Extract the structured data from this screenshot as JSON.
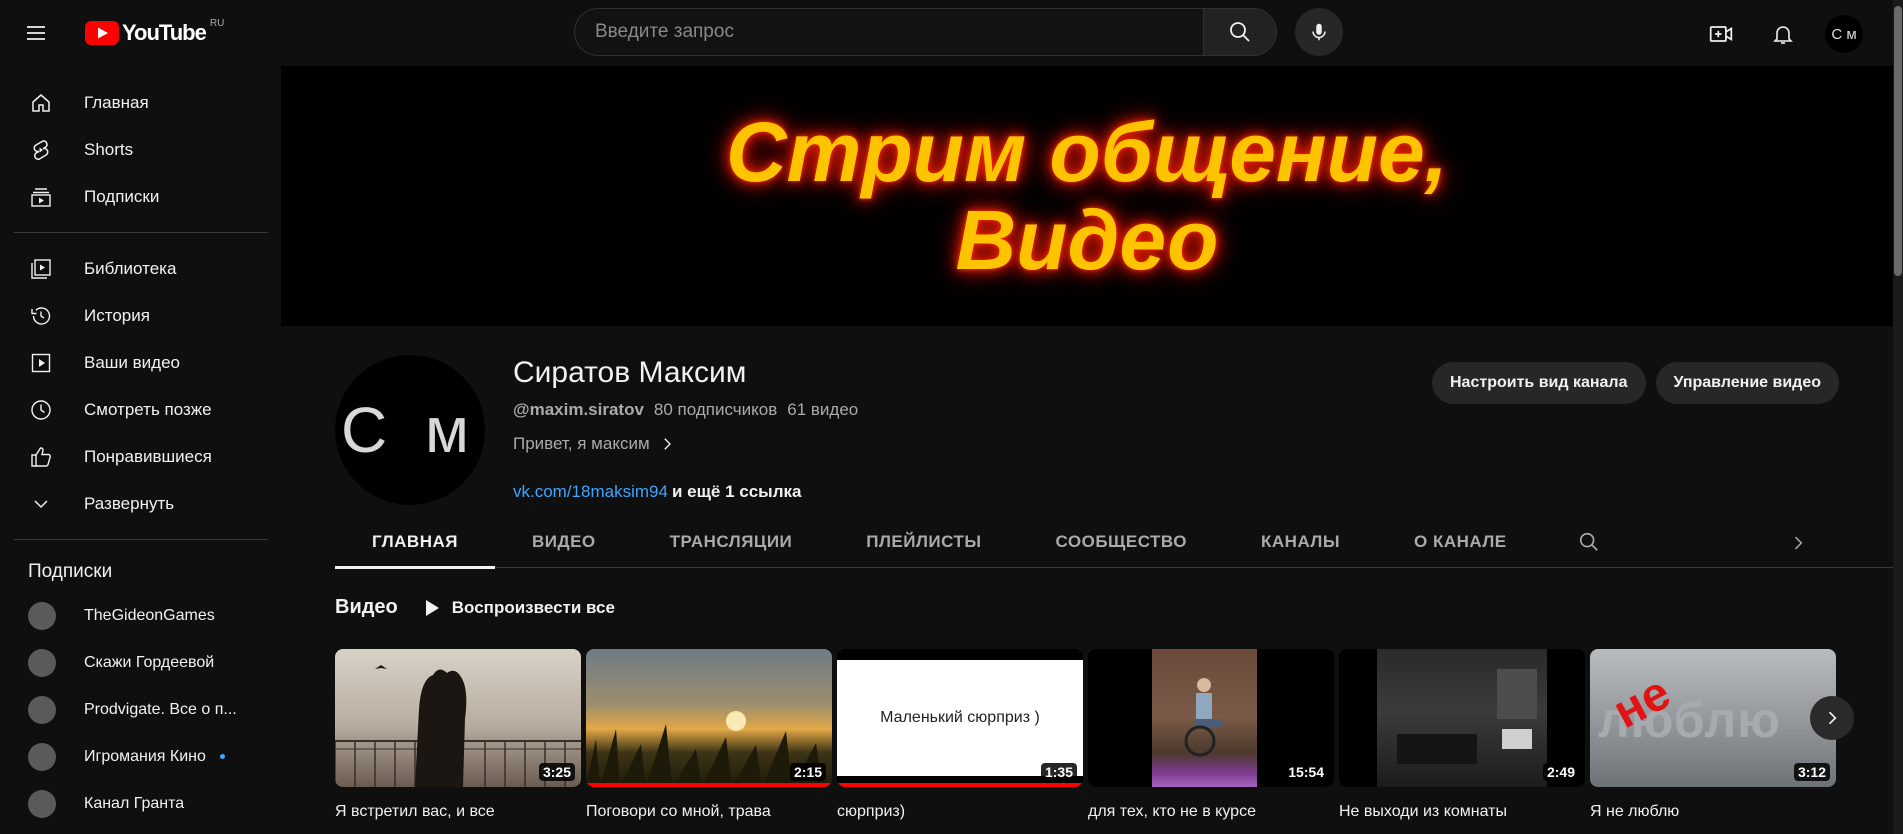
{
  "header": {
    "logo_text": "YouTube",
    "logo_region": "RU",
    "search_placeholder": "Введите запрос",
    "avatar_initials": "С м"
  },
  "sidebar": {
    "main_items": [
      {
        "label": "Главная",
        "icon": "home-icon"
      },
      {
        "label": "Shorts",
        "icon": "shorts-icon"
      },
      {
        "label": "Подписки",
        "icon": "subscriptions-icon"
      }
    ],
    "library_items": [
      {
        "label": "Библиотека",
        "icon": "library-icon"
      },
      {
        "label": "История",
        "icon": "history-icon"
      },
      {
        "label": "Ваши видео",
        "icon": "your-videos-icon"
      },
      {
        "label": "Смотреть позже",
        "icon": "watch-later-icon"
      },
      {
        "label": "Понравившиеся",
        "icon": "thumbs-up-icon"
      },
      {
        "label": "Развернуть",
        "icon": "chevron-down-icon"
      }
    ],
    "subscriptions_heading": "Подписки",
    "subscriptions": [
      {
        "name": "TheGideonGames",
        "new": false
      },
      {
        "name": "Скажи Гордеевой",
        "new": false
      },
      {
        "name": "Prodvigate. Все о п...",
        "new": false
      },
      {
        "name": "Игромания Кино",
        "new": true
      },
      {
        "name": "Канал Гранта",
        "new": false
      }
    ]
  },
  "banner": {
    "line1": "Стрим общение,",
    "line2": "Видео"
  },
  "channel": {
    "avatar_initials": "С м",
    "name": "Сиратов Максим",
    "handle": "@maxim.siratov",
    "subscribers": "80 подписчиков",
    "videos_count": "61 видео",
    "description": "Привет, я максим",
    "link": "vk.com/18maksim94",
    "more_links": "и ещё 1 ссылка",
    "customize_button": "Настроить вид канала",
    "manage_button": "Управление видео"
  },
  "tabs": [
    {
      "label": "ГЛАВНАЯ",
      "active": true
    },
    {
      "label": "ВИДЕО",
      "active": false
    },
    {
      "label": "ТРАНСЛЯЦИИ",
      "active": false
    },
    {
      "label": "ПЛЕЙЛИСТЫ",
      "active": false
    },
    {
      "label": "СООБЩЕСТВО",
      "active": false
    },
    {
      "label": "КАНАЛЫ",
      "active": false
    },
    {
      "label": "О КАНАЛЕ",
      "active": false
    }
  ],
  "shelf": {
    "title": "Видео",
    "play_all": "Воспроизвести все",
    "videos": [
      {
        "title": "Я встретил вас, и все",
        "duration": "3:25",
        "progress": 0
      },
      {
        "title": "Поговори со мной, трава",
        "duration": "2:15",
        "progress": 1.0
      },
      {
        "title": "сюрприз)",
        "duration": "1:35",
        "progress": 1.0,
        "thumb_text": "Маленький сюрприз )"
      },
      {
        "title": "для тех, кто не в курсе",
        "duration": "15:54",
        "progress": 0
      },
      {
        "title": "Не выходи из комнаты",
        "duration": "2:49",
        "progress": 0
      },
      {
        "title": "Я не люблю",
        "duration": "3:12",
        "progress": 0,
        "thumb_text": "не",
        "thumb_text2": "люблю"
      }
    ]
  },
  "colors": {
    "background": "#0f0f0f",
    "accent_red": "#ff0000",
    "link_blue": "#3ea6ff",
    "banner_text": "#ffc400"
  }
}
